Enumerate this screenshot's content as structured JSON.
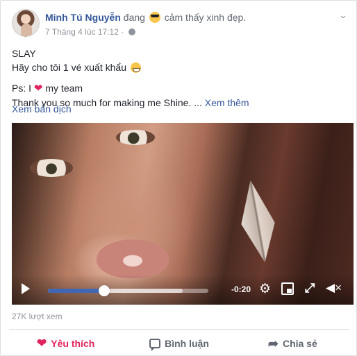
{
  "post": {
    "author": "Minh Tú Nguyễn",
    "feeling_prefix": "đang",
    "feeling_icon": "cool-face-emoji",
    "feeling_text": "cảm thấy xinh đẹp.",
    "timestamp": "7 Tháng 4 lúc 17:12",
    "separator": "·",
    "privacy_icon": "globe-icon",
    "menu_icon": "chevron-down-icon"
  },
  "body": {
    "line1": "SLAY",
    "line2": "Hãy cho tôi 1 vé xuất khẩu",
    "line2_emoji": "grinning-face-emoji",
    "line3_prefix": "Ps: I",
    "line3_heart": "❤",
    "line3_suffix": "my team",
    "line4": "Thank you so much for making me Shine. ...",
    "see_more": "Xem thêm",
    "translate": "Xem bản dịch"
  },
  "video": {
    "time_remaining": "-0:20",
    "played_fraction": 0.35,
    "buffered_fraction": 0.84
  },
  "stats": {
    "views": "27K lượt xem"
  },
  "actions": {
    "like": "Yêu thích",
    "comment": "Bình luận",
    "share": "Chia sẻ"
  },
  "colors": {
    "accent": "#365899",
    "love": "#e0245e",
    "progress": "#4267b2"
  }
}
